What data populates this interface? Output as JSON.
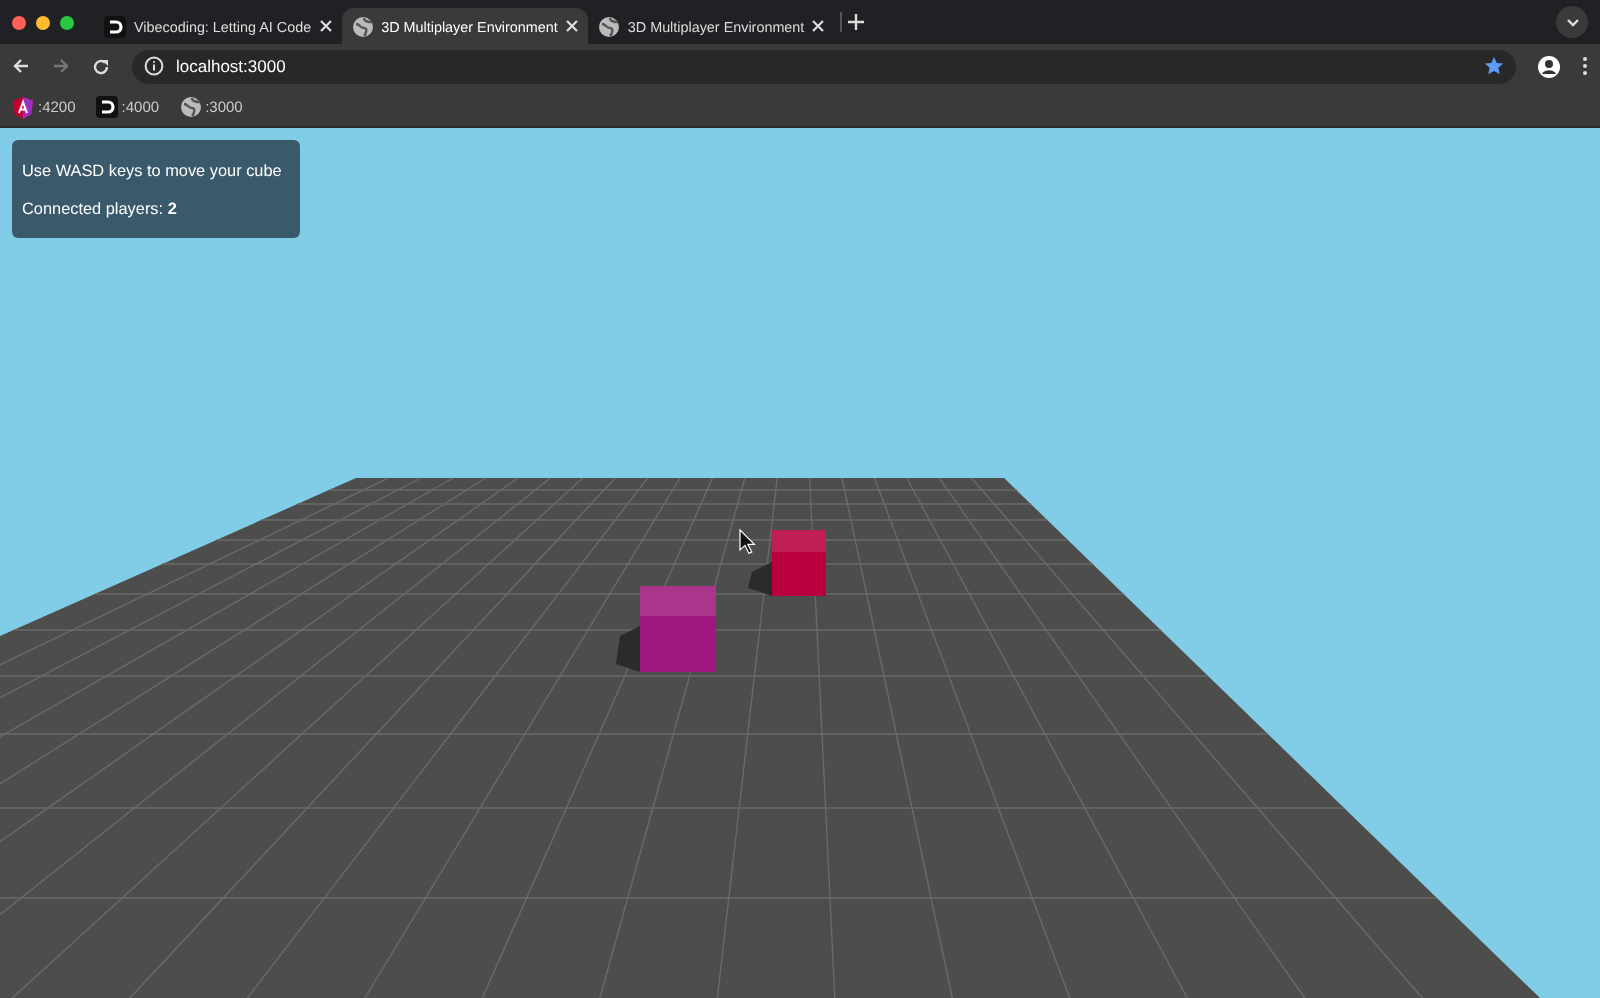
{
  "browser": {
    "tabs": [
      {
        "title": "Vibecoding: Letting AI Code",
        "kind": "logo",
        "selected": false
      },
      {
        "title": "3D Multiplayer Environment",
        "kind": "globe",
        "selected": true
      },
      {
        "title": "3D Multiplayer Environment",
        "kind": "globe",
        "selected": false
      }
    ],
    "address": "localhost:3000",
    "bookmarked": true,
    "bookmarks": [
      {
        "label": ":4200",
        "kind": "shield"
      },
      {
        "label": ":4000",
        "kind": "logo"
      },
      {
        "label": ":3000",
        "kind": "globe"
      }
    ]
  },
  "info_panel": {
    "instruction": "Use WASD keys to move your cube",
    "players": "Connected players: **2**"
  },
  "scene": {
    "cubes": [
      {
        "color": "#b8003c"
      },
      {
        "color": "#a0187e"
      }
    ]
  }
}
